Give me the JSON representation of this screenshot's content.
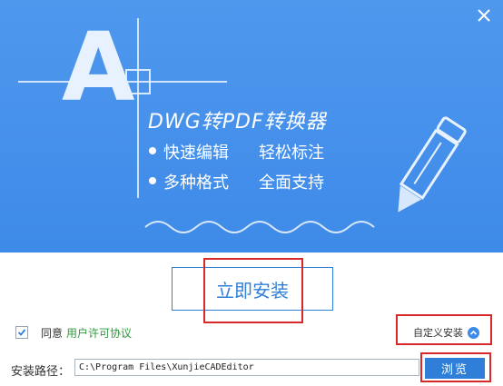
{
  "banner": {
    "logo_letter": "A",
    "product_title": "DWG转PDF转换器",
    "features": [
      "快速编辑",
      "轻松标注",
      "多种格式",
      "全面支持"
    ]
  },
  "actions": {
    "install_label": "立即安装",
    "agree_label": "同意",
    "license_link": "用户许可协议",
    "agreed": true,
    "custom_install_label": "自定义安装"
  },
  "install_path": {
    "label": "安装路径：",
    "value": "C:\\Program Files\\XunjieCADEditor",
    "browse_label": "浏览"
  },
  "colors": {
    "banner_blue": "#4f98ee",
    "button_blue": "#2f7fd8",
    "link_green": "#2a9a3a",
    "highlight_red": "#d8282a"
  },
  "icons": [
    "close-icon",
    "pen-icon",
    "check-icon",
    "chevron-up-icon"
  ]
}
